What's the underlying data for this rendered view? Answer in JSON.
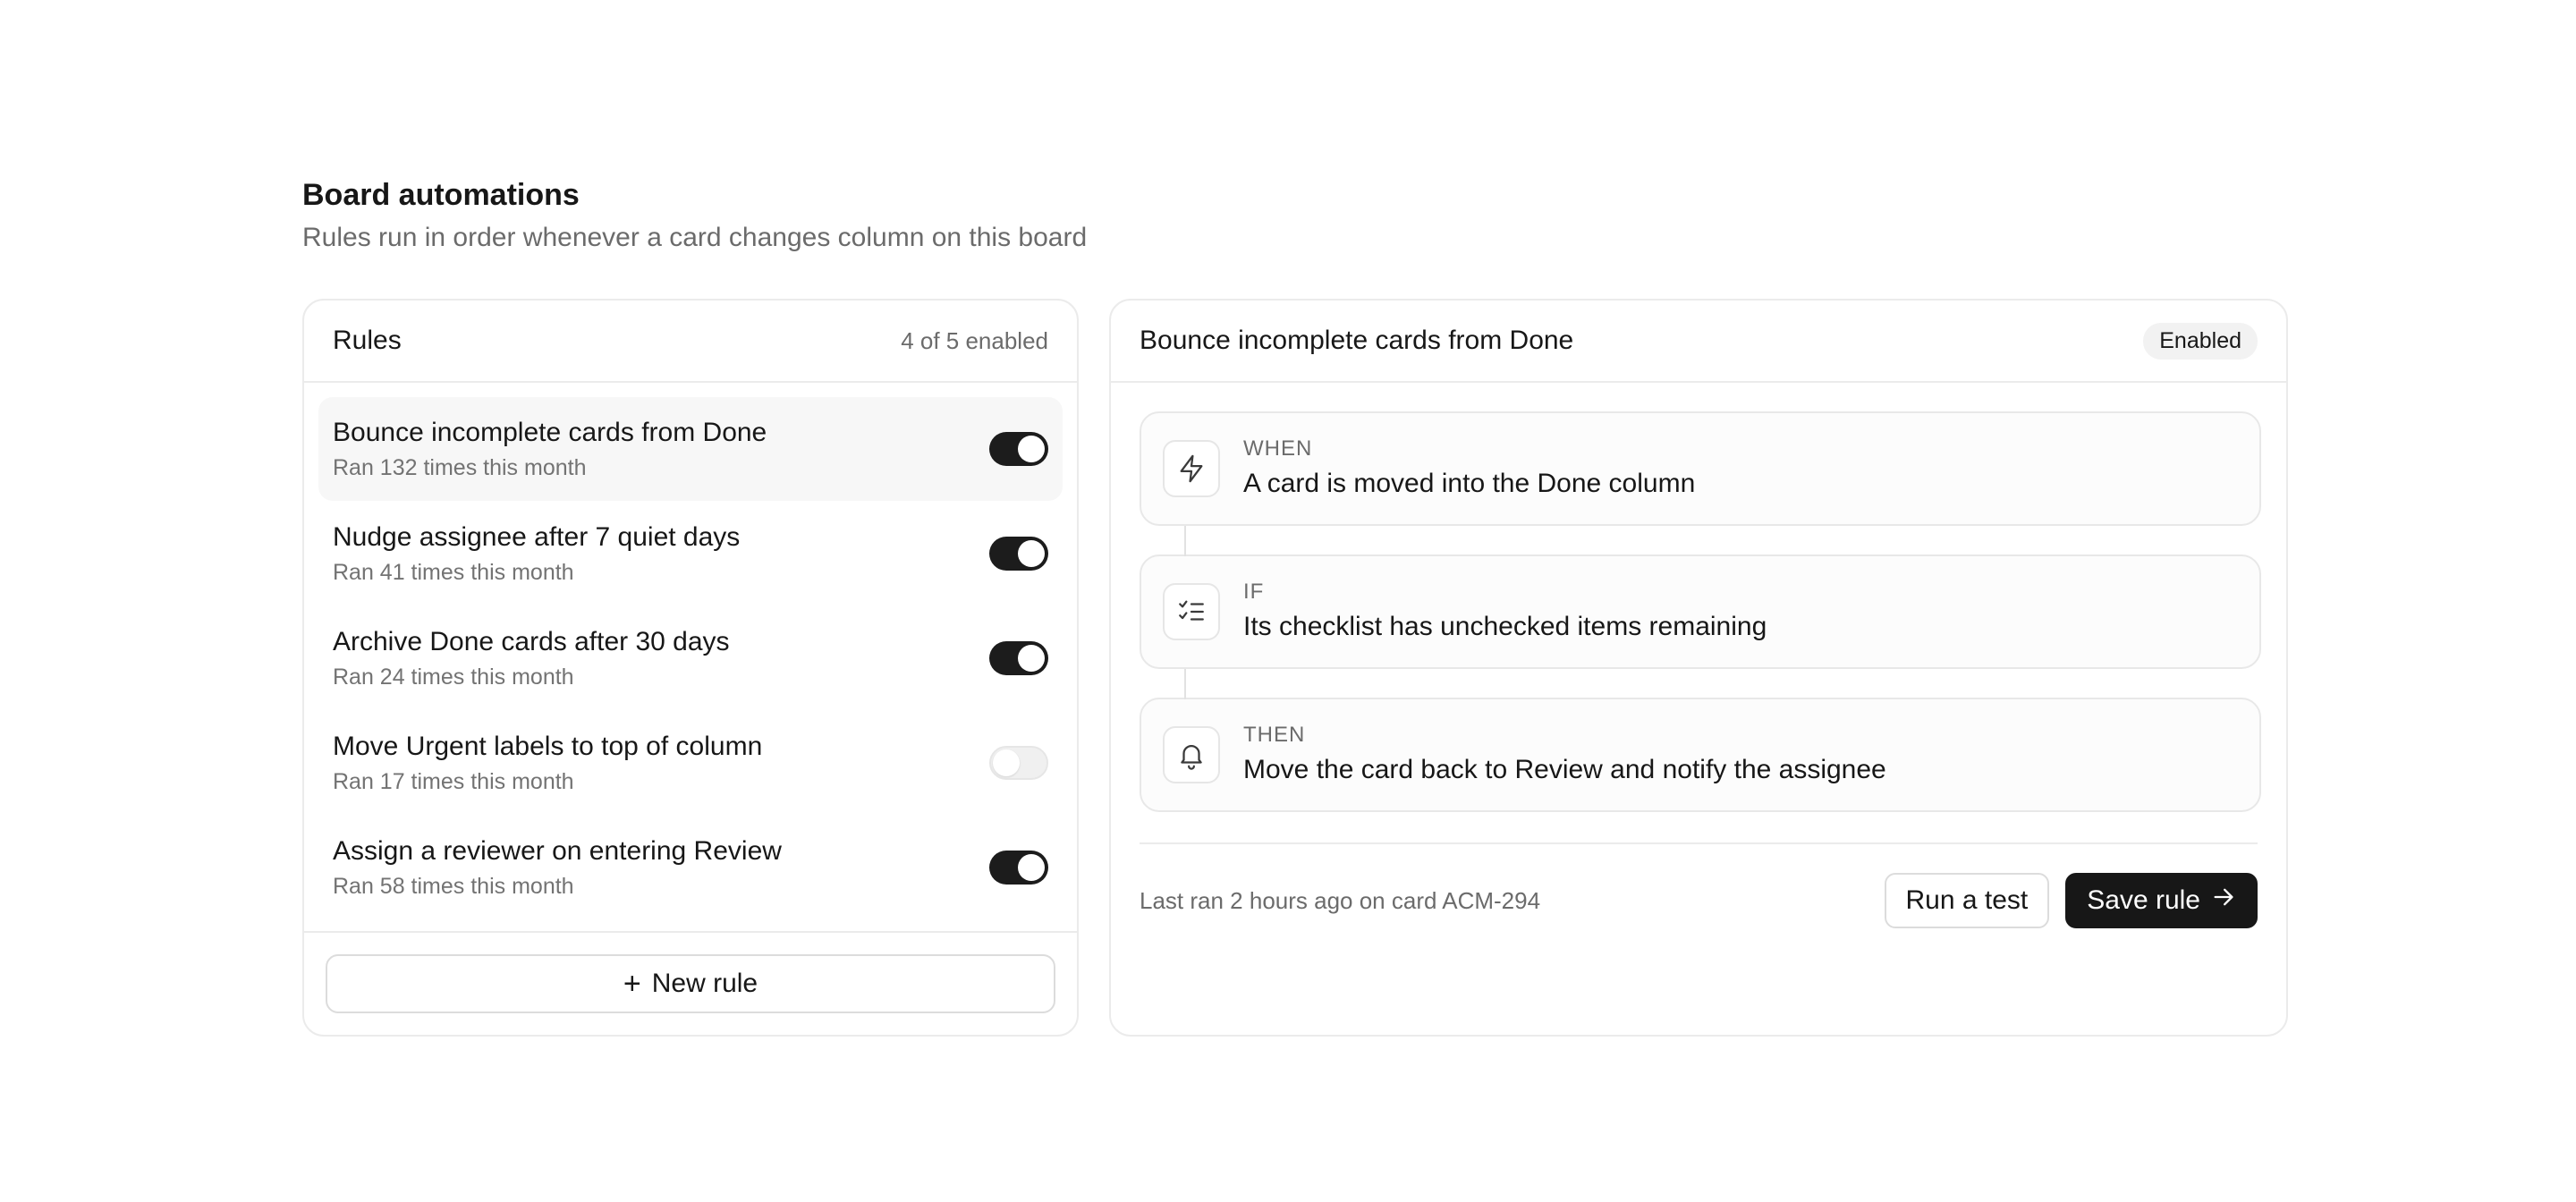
{
  "header": {
    "title": "Board automations",
    "subtitle": "Rules run in order whenever a card changes column on this board"
  },
  "rules_panel": {
    "title": "Rules",
    "enabled_count": "4 of 5 enabled",
    "items": [
      {
        "name": "Bounce incomplete cards from Done",
        "meta": "Ran 132 times this month",
        "enabled": true,
        "selected": true
      },
      {
        "name": "Nudge assignee after 7 quiet days",
        "meta": "Ran 41 times this month",
        "enabled": true,
        "selected": false
      },
      {
        "name": "Archive Done cards after 30 days",
        "meta": "Ran 24 times this month",
        "enabled": true,
        "selected": false
      },
      {
        "name": "Move Urgent labels to top of column",
        "meta": "Ran 17 times this month",
        "enabled": false,
        "selected": false
      },
      {
        "name": "Assign a reviewer on entering Review",
        "meta": "Ran 58 times this month",
        "enabled": true,
        "selected": false
      }
    ],
    "new_rule_label": "New rule"
  },
  "detail": {
    "title": "Bounce incomplete cards from Done",
    "status": "Enabled",
    "steps": [
      {
        "label": "WHEN",
        "text": "A card is moved into the Done column",
        "icon": "lightning-icon"
      },
      {
        "label": "IF",
        "text": "Its checklist has unchecked items remaining",
        "icon": "checklist-icon"
      },
      {
        "label": "THEN",
        "text": "Move the card back to Review and notify the assignee",
        "icon": "bell-icon"
      }
    ],
    "last_ran": "Last ran 2 hours ago on card ACM-294",
    "run_test_label": "Run a test",
    "save_label": "Save rule"
  }
}
